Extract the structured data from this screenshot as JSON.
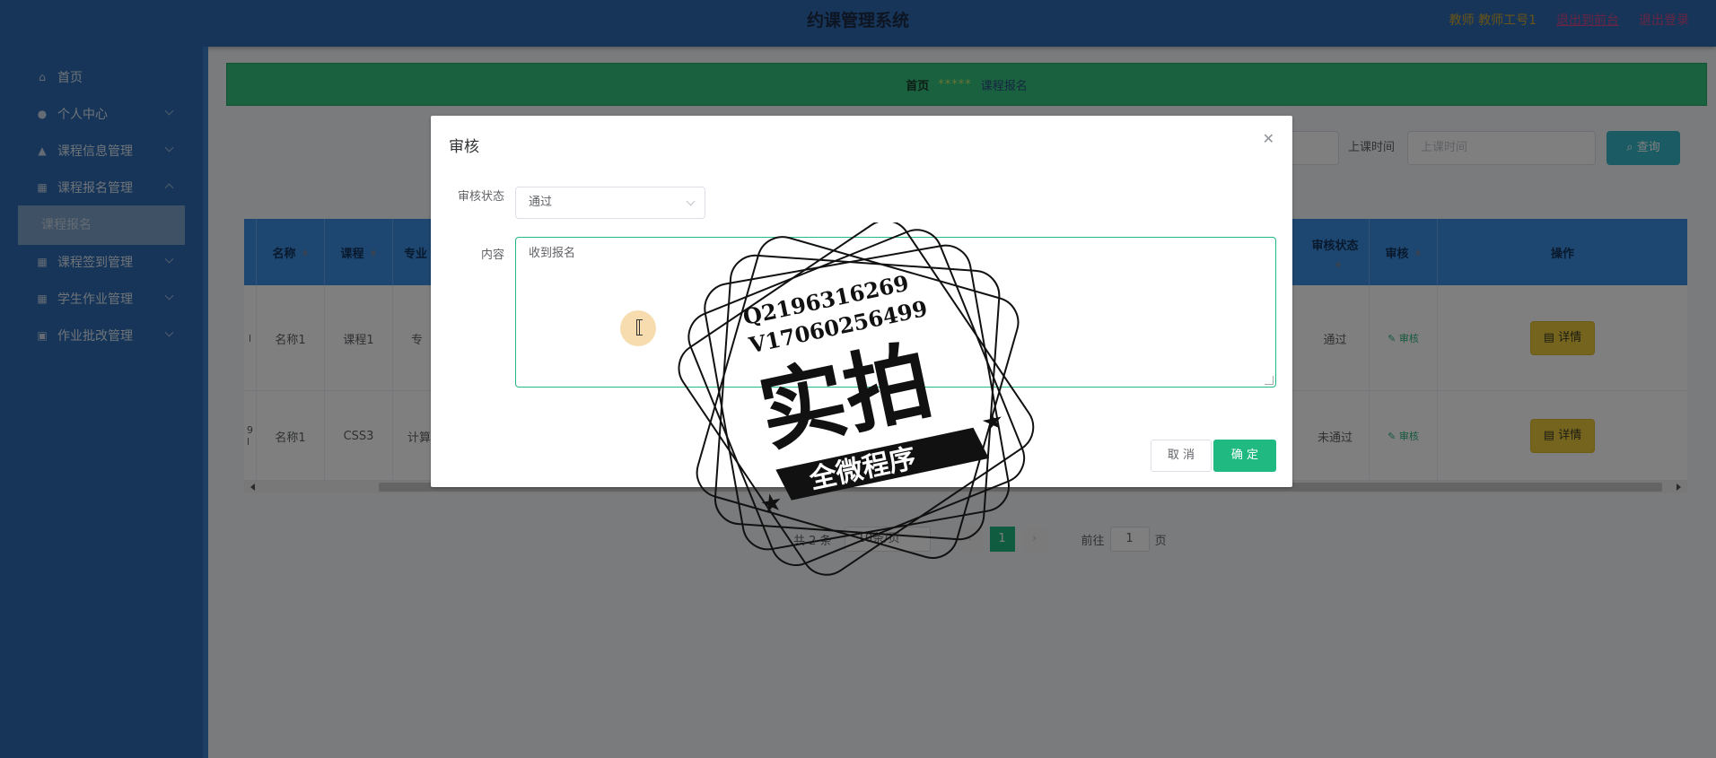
{
  "header": {
    "title": "约课管理系统",
    "user_info": "教师 教师工号1",
    "back_front": "退出到前台",
    "logout": "退出登录"
  },
  "sidebar": {
    "items": [
      {
        "label": "首页",
        "icon": "home-icon"
      },
      {
        "label": "个人中心",
        "icon": "user-icon"
      },
      {
        "label": "课程信息管理",
        "icon": "user-icon"
      },
      {
        "label": "课程报名管理",
        "icon": "grid-icon"
      },
      {
        "label": "课程签到管理",
        "icon": "grid-icon"
      },
      {
        "label": "学生作业管理",
        "icon": "grid-icon"
      },
      {
        "label": "作业批改管理",
        "icon": "card-icon"
      }
    ],
    "sub_active": "课程报名"
  },
  "breadcrumb": {
    "home": "首页",
    "separator": "*****",
    "current": "课程报名"
  },
  "search": {
    "label": "上课时间",
    "placeholder": "上课时间",
    "button": "查询"
  },
  "table": {
    "headers": [
      "名称",
      "课程",
      "专业",
      "审核状态",
      "审核",
      "操作"
    ],
    "rows": [
      {
        "name": "名称1",
        "course": "课程1",
        "major": "专",
        "status": "通过",
        "audit": "审核",
        "detail": "详情",
        "edge": "l"
      },
      {
        "name": "名称1",
        "course": "CSS3",
        "major": "计算",
        "status": "未通过",
        "audit": "审核",
        "detail": "详情",
        "edge": "9\nl"
      }
    ]
  },
  "pager": {
    "total": "共 2 条",
    "page_size": "10条/页",
    "current": "1",
    "goto": "前往",
    "goto_value": "1",
    "page_unit": "页"
  },
  "dialog": {
    "title": "审核",
    "status_label": "审核状态",
    "status_value": "通过",
    "content_label": "内容",
    "content_value": "收到报名",
    "cancel": "取 消",
    "confirm": "确 定"
  },
  "watermark": {
    "line1": "Q2196316269",
    "line2": "V17060256499",
    "main": "实拍",
    "banner": "全微程序"
  },
  "colors": {
    "topbar": "#2d6bb0",
    "accent_green": "#1fb981",
    "breadcrumb_bg": "#33c27f",
    "table_header": "#3b8fe0",
    "detail_button": "#e8c93a"
  }
}
